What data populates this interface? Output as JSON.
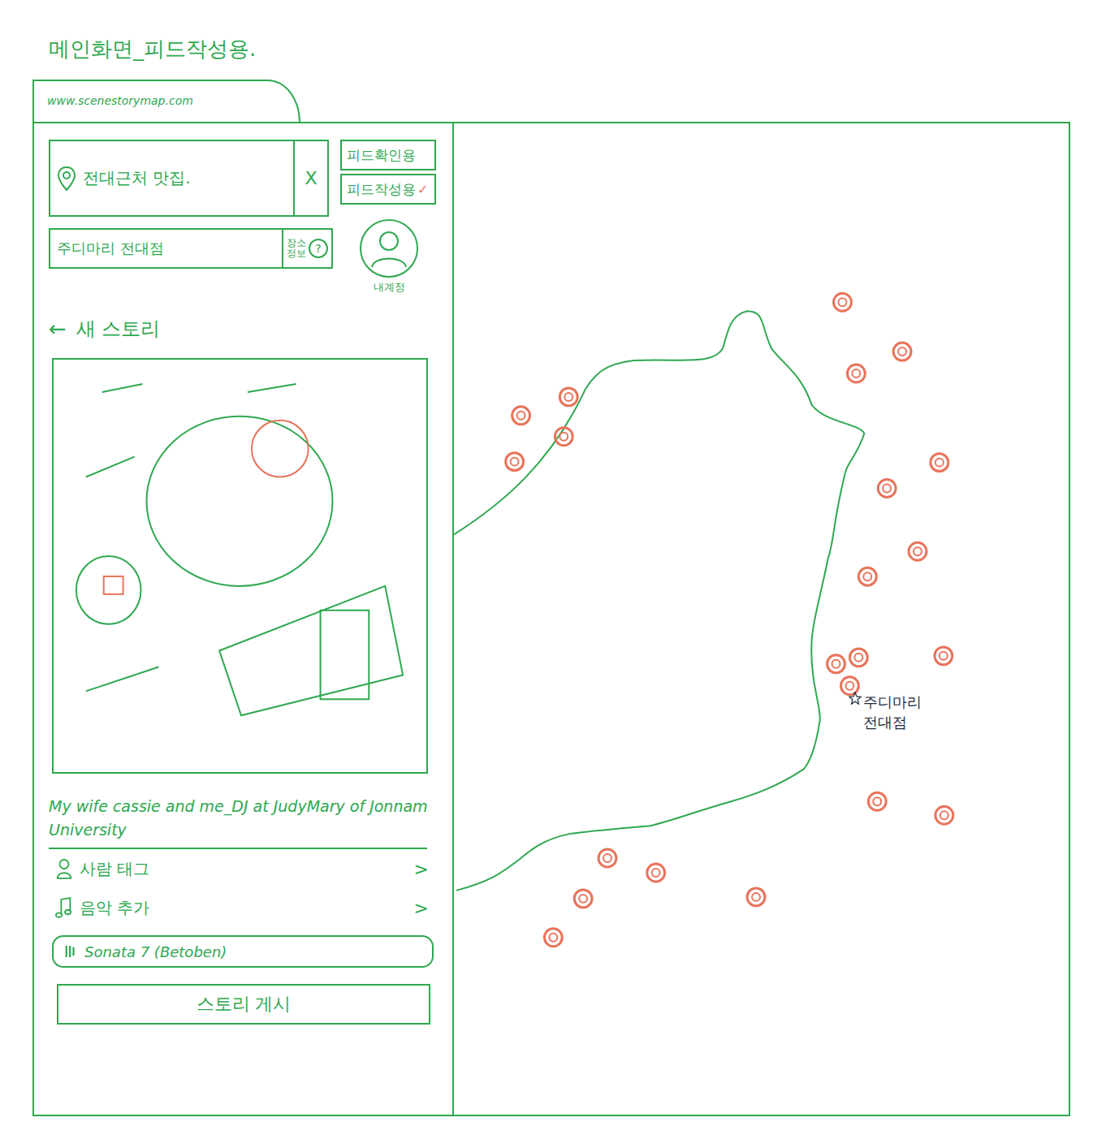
{
  "page_title": "메인화면_피드작성용.",
  "browser": {
    "url": "www.scenestorymap.com"
  },
  "search": {
    "value": "전대근처 맛집.",
    "clear": "X"
  },
  "modes": [
    {
      "label": "피드확인용",
      "selected": false
    },
    {
      "label": "피드작성용",
      "selected": true
    }
  ],
  "mode_check": "✓",
  "place": {
    "value": "주디마리 전대점",
    "info_button": "장소정보",
    "info_icon": "?"
  },
  "account": {
    "label": "내계정"
  },
  "story": {
    "back": "←",
    "title": "새 스토리",
    "caption": "My wife cassie and me_DJ at JudyMary of Jonnam University",
    "options": [
      {
        "kind": "person",
        "label": "사람 태그",
        "chevron": ">"
      },
      {
        "kind": "music",
        "label": "음악 추가",
        "chevron": ">"
      }
    ],
    "music": {
      "title": "Sonata 7 (Betoben)"
    },
    "post_button": "스토리 게시"
  },
  "map": {
    "selected_place": "주디마리 전대점"
  }
}
